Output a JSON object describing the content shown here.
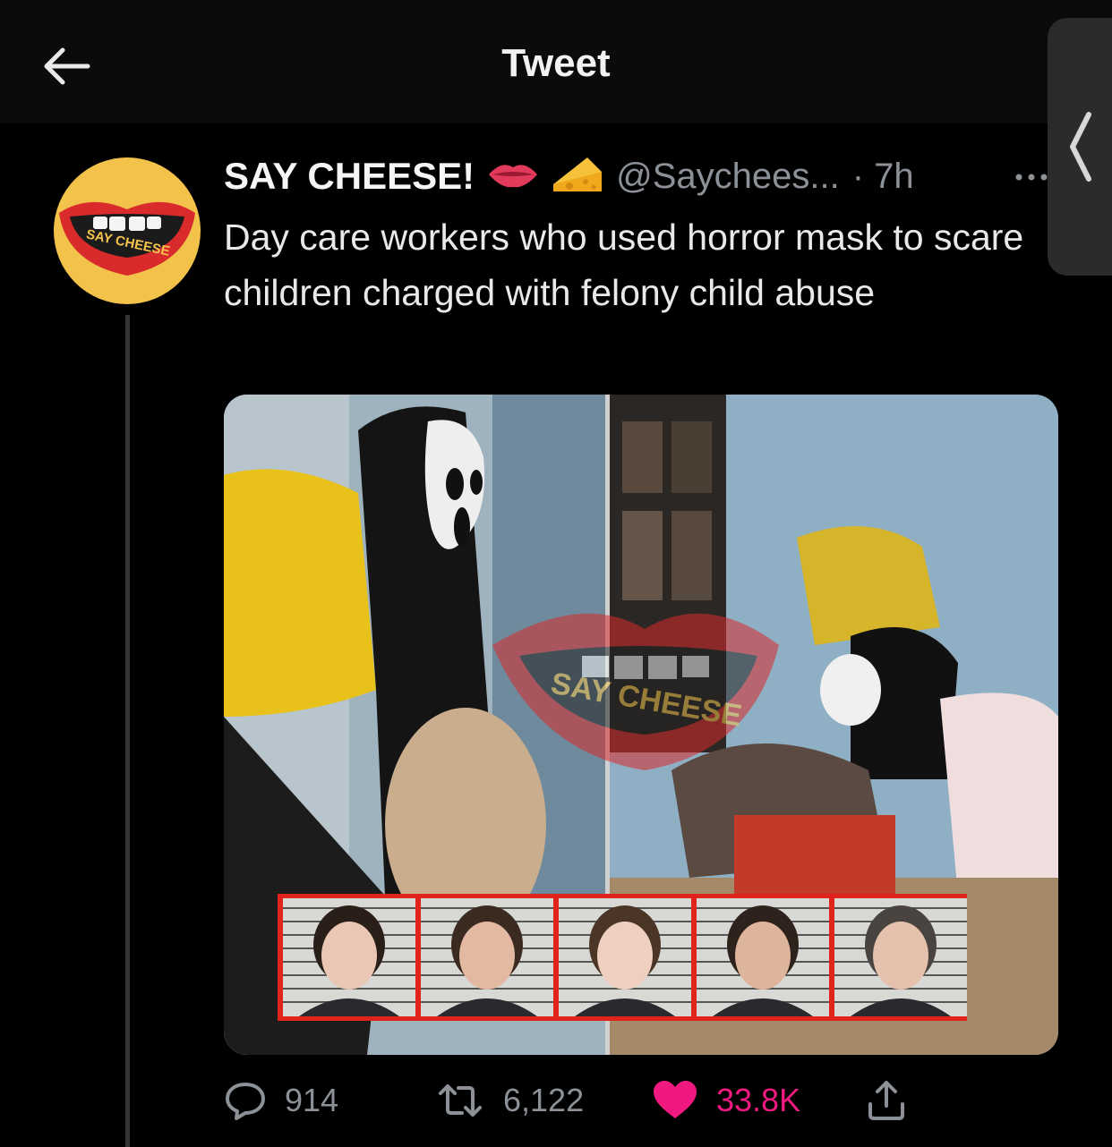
{
  "header": {
    "title": "Tweet",
    "back_icon": "arrow-left-icon"
  },
  "tweet": {
    "author_name": "SAY CHEESE!",
    "emojis": [
      "lips-emoji",
      "cheese-emoji"
    ],
    "handle": "@Saychees...",
    "time": "· 7h",
    "more_icon": "more-horizontal-icon",
    "text": "Day care workers who used horror mask to scare children charged with felony child abuse",
    "avatar": {
      "text": "SAY CHEESE",
      "bg_color": "#f2c24b",
      "lip_color": "#d92b2b"
    },
    "media": {
      "watermark_text": "SAY CHEESE",
      "mugshot_border_color": "#e0241b",
      "mugshot_count": 5
    },
    "actions": {
      "reply_count": "914",
      "retweet_count": "6,122",
      "like_count": "33.8K",
      "like_color": "#f0197f",
      "liked": true
    }
  }
}
